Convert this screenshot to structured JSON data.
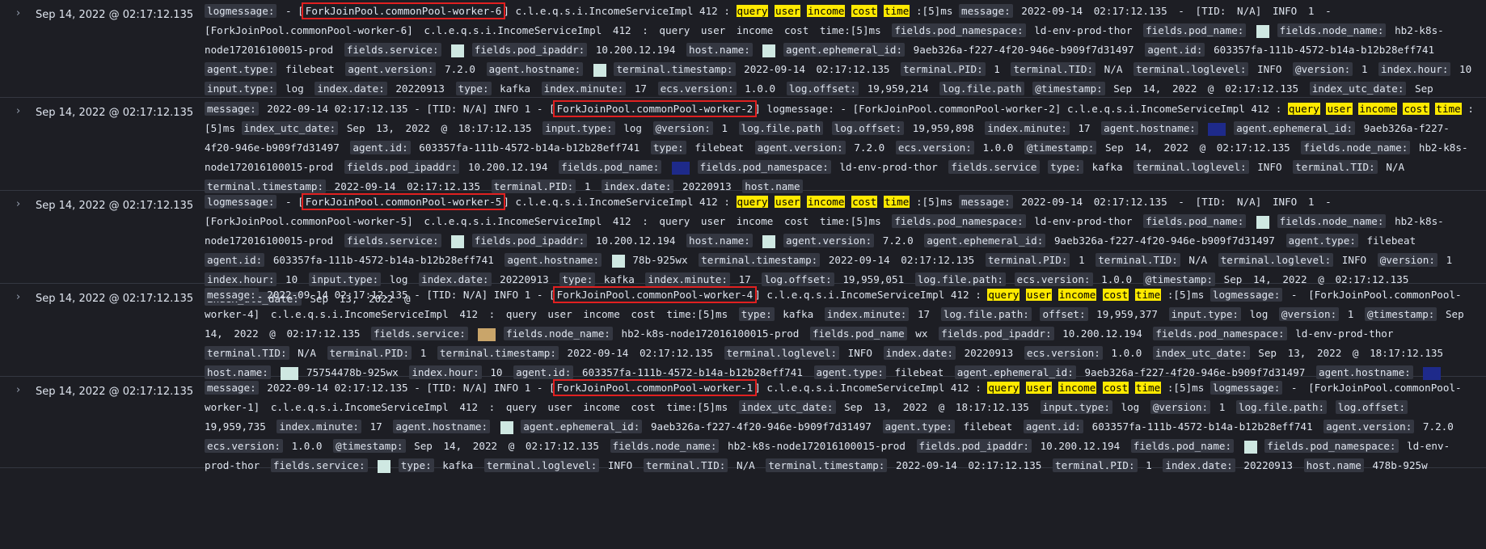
{
  "rows": [
    {
      "timestamp": "Sep 14, 2022 @ 02:17:12.135",
      "worker": "ForkJoinPool.commonPool-worker-6",
      "lead": "logmessage:",
      "prefix": "- [",
      "suffix": "] c.l.e.q.s.i.IncomeServiceImpl 412 :",
      "hl": [
        "query",
        "user",
        "income",
        "cost",
        "time"
      ],
      "tail": ":[5]ms",
      "rest": "message: 2022-09-14 02:17:12.135 - [TID: N/A] INFO 1 - [ForkJoinPool.commonPool-worker-6] c.l.e.q.s.i.IncomeServiceImpl 412 : query user income cost time:[5]ms fields.pod_namespace: ld-env-prod-thor fields.pod_name: fields.node_name: hb2-k8s-node172016100015-prod fields.service: fields.pod_ipaddr: 10.200.12.194 host.name: agent.ephemeral_id: 9aeb326a-f227-4f20-946e-b909f7d31497 agent.id: 603357fa-111b-4572-b14a-b12b28eff741 agent.type: filebeat agent.version: 7.2.0 agent.hostname: terminal.timestamp: 2022-09-14 02:17:12.135 terminal.PID: 1 terminal.TID: N/A terminal.loglevel: INFO @version: 1 index.hour: 10 input.type: log index.date: 20220913 type: kafka index.minute: 17 ecs.version: 1.0.0 log.offset: 19,959,214 log.file.path @timestamp: Sep 14, 2022 @ 02:17:12.135 index_utc_date: Sep"
    },
    {
      "timestamp": "Sep 14, 2022 @ 02:17:12.135",
      "worker": "ForkJoinPool.commonPool-worker-2",
      "lead": "message:",
      "prefix": "2022-09-14 02:17:12.135 - [TID: N/A] INFO 1 - [",
      "suffix": "] logmessage: - [ForkJoinPool.commonPool-worker-2] c.l.e.q.s.i.IncomeServiceImpl 412 :",
      "hl": [
        "query",
        "user",
        "income",
        "cost",
        "time"
      ],
      "tail": ":[5]ms",
      "rest": "index_utc_date: Sep 13, 2022 @ 18:17:12.135 input.type: log @version: 1 log.file.path log.offset: 19,959,898 index.minute: 17 agent.hostname: agent.ephemeral_id: 9aeb326a-f227-4f20-946e-b909f7d31497 agent.id: 603357fa-111b-4572-b14a-b12b28eff741 type: filebeat agent.version: 7.2.0 ecs.version: 1.0.0 @timestamp: Sep 14, 2022 @ 02:17:12.135 fields.node_name: hb2-k8s-node172016100015-prod fields.pod_ipaddr: 10.200.12.194 fields.pod_name: fields.pod_namespace: ld-env-prod-thor fields.service type: kafka terminal.loglevel: INFO terminal.TID: N/A terminal.timestamp: 2022-09-14 02:17:12.135 terminal.PID: 1 index.date: 20220913 host.name"
    },
    {
      "timestamp": "Sep 14, 2022 @ 02:17:12.135",
      "worker": "ForkJoinPool.commonPool-worker-5",
      "lead": "logmessage:",
      "prefix": "- [",
      "suffix": "] c.l.e.q.s.i.IncomeServiceImpl 412 :",
      "hl": [
        "query",
        "user",
        "income",
        "cost",
        "time"
      ],
      "tail": ":[5]ms",
      "rest": "message: 2022-09-14 02:17:12.135 - [TID: N/A] INFO 1 - [ForkJoinPool.commonPool-worker-5] c.l.e.q.s.i.IncomeServiceImpl 412 : query user income cost time:[5]ms fields.pod_namespace: ld-env-prod-thor fields.pod_name: fields.node_name: hb2-k8s-node172016100015-prod fields.service: fields.pod_ipaddr: 10.200.12.194 host.name: agent.version: 7.2.0 agent.ephemeral_id: 9aeb326a-f227-4f20-946e-b909f7d31497 agent.type: filebeat agent.id: 603357fa-111b-4572-b14a-b12b28eff741 agent.hostname: 78b-925wx terminal.timestamp: 2022-09-14 02:17:12.135 terminal.PID: 1 terminal.TID: N/A terminal.loglevel: INFO @version: 1 index.hour: 10 input.type: log index.date: 20220913 type: kafka index.minute: 17 log.offset: 19,959,051 log.file.path: ecs.version: 1.0.0 @timestamp: Sep 14, 2022 @ 02:17:12.135 index_utc_date: Sep 13, 2022 @"
    },
    {
      "timestamp": "Sep 14, 2022 @ 02:17:12.135",
      "worker": "ForkJoinPool.commonPool-worker-4",
      "lead": "message:",
      "prefix": "2022-09-14 02:17:12.135 - [TID: N/A] INFO 1 - [",
      "suffix": "] c.l.e.q.s.i.IncomeServiceImpl 412 :",
      "hl": [
        "query",
        "user",
        "income",
        "cost",
        "time"
      ],
      "tail": ":[5]ms",
      "rest": "logmessage: - [ForkJoinPool.commonPool-worker-4] c.l.e.q.s.i.IncomeServiceImpl 412 : query user income cost time:[5]ms type: kafka index.minute: 17 log.file.path: offset: 19,959,377 input.type: log @version: 1 @timestamp: Sep 14, 2022 @ 02:17:12.135 fields.service: fields.node_name: hb2-k8s-node172016100015-prod fields.pod_name wx fields.pod_ipaddr: 10.200.12.194 fields.pod_namespace: ld-env-prod-thor terminal.TID: N/A terminal.PID: 1 terminal.timestamp: 2022-09-14 02:17:12.135 terminal.loglevel: INFO index.date: 20220913 ecs.version: 1.0.0 index_utc_date: Sep 13, 2022 @ 18:17:12.135 host.name: 75754478b-925wx index.hour: 10 agent.id: 603357fa-111b-4572-b14a-b12b28eff741 agent.type: filebeat agent.ephemeral_id: 9aeb326a-f227-4f20-946e-b909f7d31497 agent.hostname:"
    },
    {
      "timestamp": "Sep 14, 2022 @ 02:17:12.135",
      "worker": "ForkJoinPool.commonPool-worker-1",
      "lead": "message:",
      "prefix": "2022-09-14 02:17:12.135 - [TID: N/A] INFO 1 - [",
      "suffix": "] c.l.e.q.s.i.IncomeServiceImpl 412 :",
      "hl": [
        "query",
        "user",
        "income",
        "cost",
        "time"
      ],
      "tail": ":[5]ms",
      "rest": "logmessage: - [ForkJoinPool.commonPool-worker-1] c.l.e.q.s.i.IncomeServiceImpl 412 : query user income cost time:[5]ms index_utc_date: Sep 13, 2022 @ 18:17:12.135 input.type: log @version: 1 log.file.path: log.offset: 19,959,735 index.minute: 17 agent.hostname: agent.ephemeral_id: 9aeb326a-f227-4f20-946e-b909f7d31497 agent.type: filebeat agent.id: 603357fa-111b-4572-b14a-b12b28eff741 agent.version: 7.2.0 ecs.version: 1.0.0 @timestamp: Sep 14, 2022 @ 02:17:12.135 fields.node_name: hb2-k8s-node172016100015-prod fields.pod_ipaddr: 10.200.12.194 fields.pod_name: fields.pod_namespace: ld-env-prod-thor fields.service: type: kafka terminal.loglevel: INFO terminal.TID: N/A terminal.timestamp: 2022-09-14 02:17:12.135 terminal.PID: 1 index.date: 20220913 host.name 478b-925w"
    }
  ],
  "colors": {
    "background": "#1d1e24",
    "highlight": "#ffe900",
    "box": "#e02020",
    "label_bg": "#343741"
  },
  "icons": {
    "expand": "chevron-right-icon"
  }
}
